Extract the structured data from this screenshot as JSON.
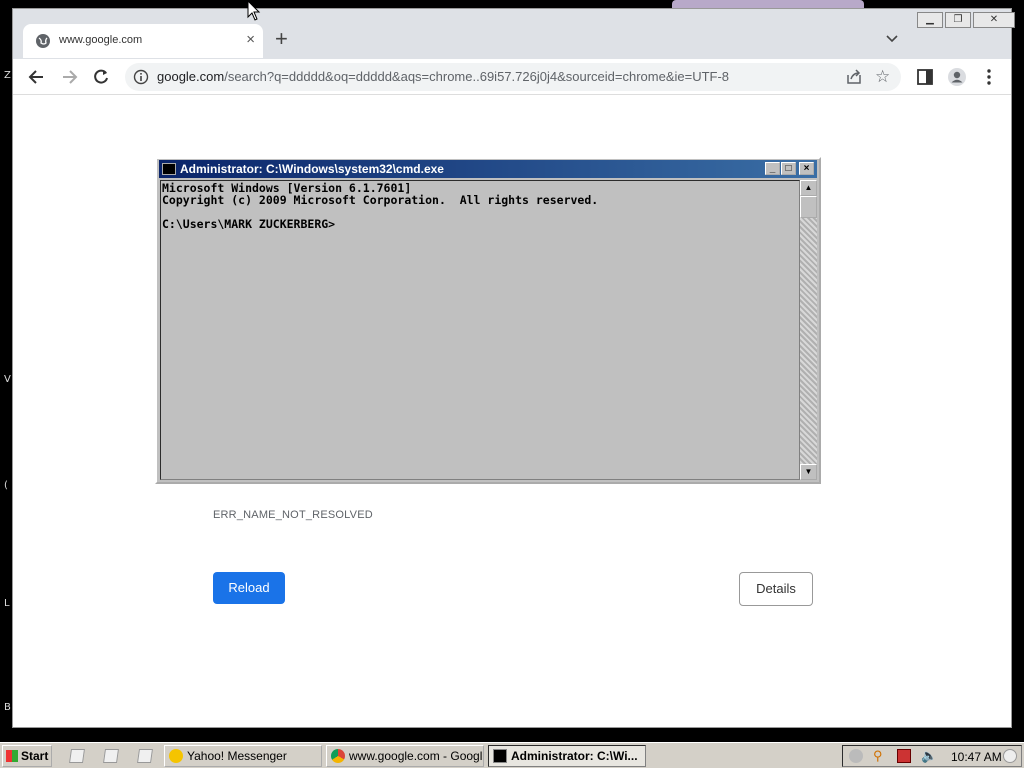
{
  "browser": {
    "tab_title": "www.google.com",
    "url_host": "google.com",
    "url_rest": "/search?q=ddddd&oq=ddddd&aqs=chrome..69i57.726j0j4&sourceid=chrome&ie=UTF-8"
  },
  "page": {
    "error_code": "ERR_NAME_NOT_RESOLVED",
    "reload_label": "Reload",
    "details_label": "Details"
  },
  "cmd": {
    "title": "Administrator: C:\\Windows\\system32\\cmd.exe",
    "lines": [
      "Microsoft Windows [Version 6.1.7601]",
      "Copyright (c) 2009 Microsoft Corporation.  All rights reserved.",
      "",
      "C:\\Users\\MARK ZUCKERBERG>"
    ]
  },
  "taskbar": {
    "start_label": "Start",
    "tasks": [
      {
        "label": "Yahoo! Messenger",
        "icon": "yahoo-messenger-icon"
      },
      {
        "label": "www.google.com - Googl...",
        "icon": "chrome-icon"
      },
      {
        "label": "Administrator: C:\\Wi...",
        "icon": "cmd-icon"
      }
    ],
    "clock": "10:47 AM"
  },
  "desktop_fragments": [
    "Z",
    "V",
    "(",
    "L",
    "B"
  ],
  "colors": {
    "reload_button": "#1a73e8",
    "cmd_titlebar": "#0a246a",
    "taskbar": "#d4d0c8"
  }
}
